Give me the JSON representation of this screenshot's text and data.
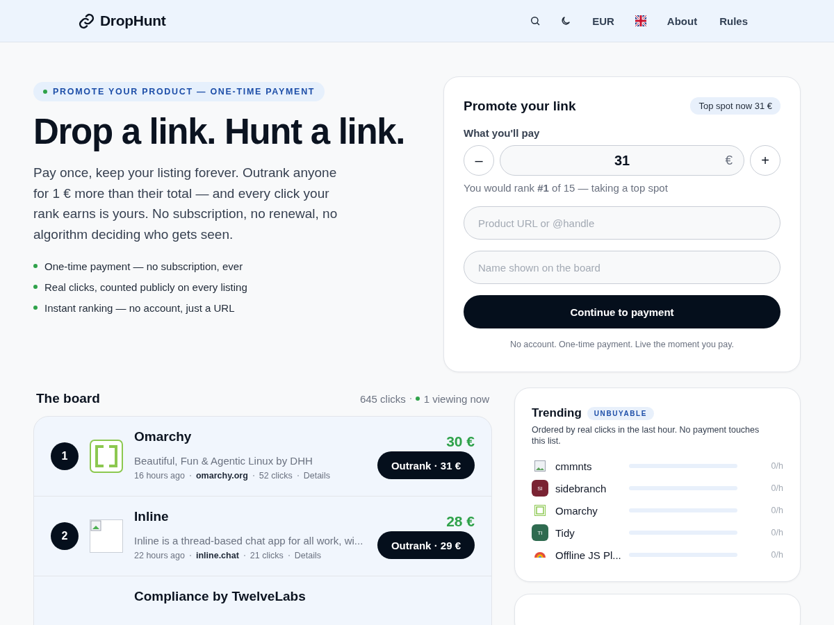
{
  "header": {
    "brand": "DropHunt",
    "nav": [
      {
        "kind": "search"
      },
      {
        "kind": "theme"
      },
      {
        "kind": "text",
        "label": "EUR"
      },
      {
        "kind": "flag"
      },
      {
        "kind": "text",
        "label": "About"
      },
      {
        "kind": "text",
        "label": "Rules"
      }
    ]
  },
  "hero": {
    "tag": "PROMOTE YOUR PRODUCT — ONE-TIME PAYMENT",
    "title": "Drop a link. Hunt a link.",
    "lead": "Pay once, keep your listing forever. Outrank anyone for 1 € more than their total — and every click your rank earns is yours. No subscription, no renewal, no algorithm deciding who gets seen.",
    "bullets": [
      "One-time payment — no subscription, ever",
      "Real clicks, counted publicly on every listing",
      "Instant ranking — no account, just a URL"
    ]
  },
  "promote": {
    "title": "Promote your link",
    "badge": "Top spot now 31 €",
    "amount_label": "What you'll pay",
    "minus": "–",
    "amount": "31",
    "currency": "€",
    "plus": "+",
    "rank_note": "You would rank **#1** of 15 — taking a top spot",
    "fields": [
      {
        "placeholder": "Product URL or @handle"
      },
      {
        "placeholder": "Name shown on the board"
      }
    ],
    "submit": "Continue to payment",
    "footnote": "No account. One-time payment. Live the moment you pay."
  },
  "board": {
    "title": "The board",
    "clicks": "645 clicks",
    "viewing": "1 viewing now",
    "rows": [
      {
        "rank": "1",
        "kind": "logo",
        "name": "Omarchy",
        "description": "Beautiful, Fun & Agentic Linux by DHH",
        "time": "16 hours ago",
        "domain": "omarchy.org",
        "clicks": "52 clicks",
        "details": "Details",
        "price": "30 €",
        "action": "Outrank · 31 €"
      },
      {
        "rank": "2",
        "kind": "broken",
        "name": "Inline",
        "description": "Inline is a thread-based chat app for all work, wi...",
        "time": "22 hours ago",
        "domain": "inline.chat",
        "clicks": "21 clicks",
        "details": "Details",
        "price": "28 €",
        "action": "Outrank · 29 €"
      },
      {
        "name": "Compliance by TwelveLabs"
      }
    ]
  },
  "trending": {
    "title": "Trending",
    "badge": "UNBUYABLE",
    "note": "Ordered by real clicks in the last hour. No payment touches this list.",
    "items": [
      {
        "kind": "picture",
        "name": "cmmnts",
        "rate": "0/h"
      },
      {
        "kind": "initials",
        "initials": "SI",
        "color": "#7a2333",
        "name": "sidebranch",
        "rate": "0/h"
      },
      {
        "kind": "logo",
        "name": "Omarchy",
        "rate": "0/h"
      },
      {
        "kind": "initials",
        "initials": "TI",
        "color": "#2f6b50",
        "name": "Tidy",
        "rate": "0/h"
      },
      {
        "kind": "rainbow",
        "name": "Offline JS Pl...",
        "rate": "0/h"
      }
    ]
  }
}
